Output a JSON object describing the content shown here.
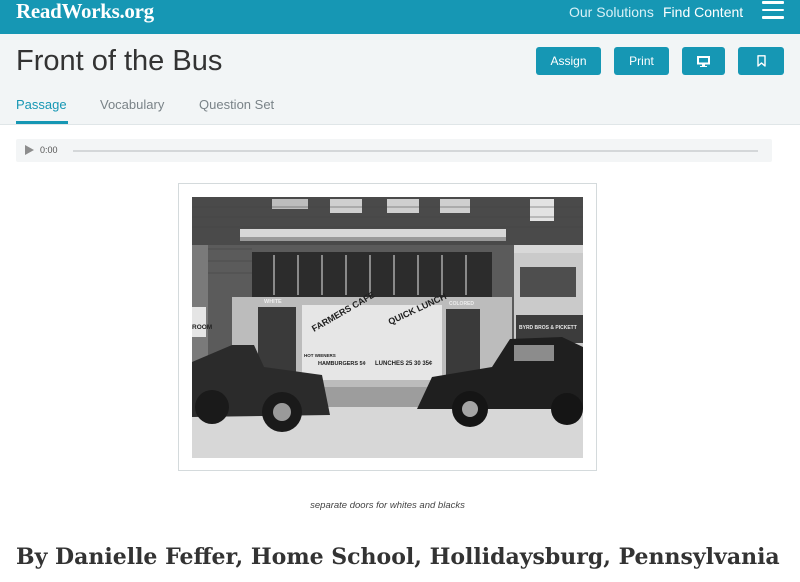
{
  "nav": {
    "logo": "ReadWorks.org",
    "links": [
      "Our Solutions",
      "Find Content"
    ]
  },
  "header": {
    "title": "Front of the Bus",
    "buttons": {
      "assign": "Assign",
      "print": "Print"
    },
    "icons": {
      "present": "monitor-icon",
      "bookmark": "bookmark-icon",
      "menu": "hamburger-menu-icon"
    },
    "tabs": [
      "Passage",
      "Vocabulary",
      "Question Set"
    ],
    "active_tab": "Passage"
  },
  "audio": {
    "time": "0:00",
    "progress": 0
  },
  "figure": {
    "sign_texts": [
      "FARMERS CAFE",
      "QUICK LUNCH",
      "WHITE",
      "COLORED",
      "HAMBURGERS 5¢",
      "LUNCHES 25 30 35¢",
      "HOT WIENERS",
      "BYRD BROS & PICKETT",
      "ROOM"
    ],
    "caption": "separate doors for whites and blacks"
  },
  "byline": "By Danielle Feffer, Home School, Hollidaysburg, Pennsylvania",
  "colors": {
    "brand": "#1697b4",
    "header_bg": "#f2f5f6",
    "text": "#333333"
  }
}
